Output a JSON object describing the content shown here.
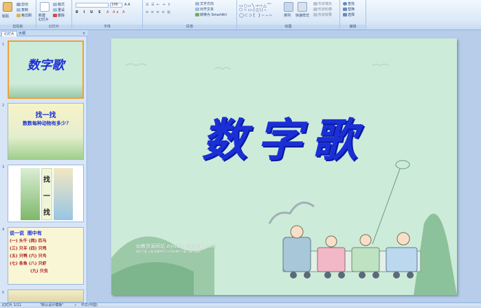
{
  "ribbon": {
    "clipboard": {
      "paste": "粘贴",
      "cut": "剪切",
      "copy": "复制",
      "format_painter": "格式刷",
      "label": "剪贴板"
    },
    "slides": {
      "new_slide": "新建\n幻灯片",
      "layout": "版式",
      "reset": "重设",
      "delete": "删除",
      "label": "幻灯片"
    },
    "font": {
      "size": "156",
      "label": "字体"
    },
    "paragraph": {
      "text_direction": "文字方向",
      "align_text": "对齐文本",
      "smartart": "转换为 SmartArt",
      "label": "段落"
    },
    "drawing": {
      "arrange": "排列",
      "quick_styles": "快速样式",
      "shape_fill": "形状填充",
      "shape_outline": "形状轮廓",
      "shape_effects": "形状效果",
      "label": "绘图"
    },
    "editing": {
      "find": "查找",
      "replace": "替换",
      "select": "选择",
      "label": "编辑"
    }
  },
  "leftpane": {
    "tabs": [
      "幻灯片",
      "大纲"
    ],
    "thumbs": [
      {
        "num": "1",
        "title": "数字歌"
      },
      {
        "num": "2",
        "title": "找一找",
        "subtitle": "数数每种动物有多少?"
      },
      {
        "num": "3",
        "title": "找一找"
      },
      {
        "num": "4",
        "title": "说一说  图中有",
        "lines": [
          "(一) 头牛 (两) 匹马",
          "(三) 只羊 (四) 只鸡",
          "(五) 只鸭 (六) 只鸟",
          "(七) 条鱼 (八) 只虾",
          "(九) 只虫"
        ]
      },
      {
        "num": "5"
      }
    ]
  },
  "slide": {
    "title": "数字歌",
    "website": "幼教资源网站  ziyuan.baby611.com",
    "website_sub": "课件下载  儿歌 故事MP3 FLASH课件下载  试卷下载等"
  },
  "status": {
    "slide_info": "幻灯片 1/11",
    "theme": "\"默认设计模板\"",
    "language": "中文(中国)"
  },
  "colors": {
    "title_blue": "#1a2fd6",
    "slide_bg": "#cdebd9",
    "ribbon_bg": "#dbe8f7",
    "selection": "#f0a030"
  }
}
